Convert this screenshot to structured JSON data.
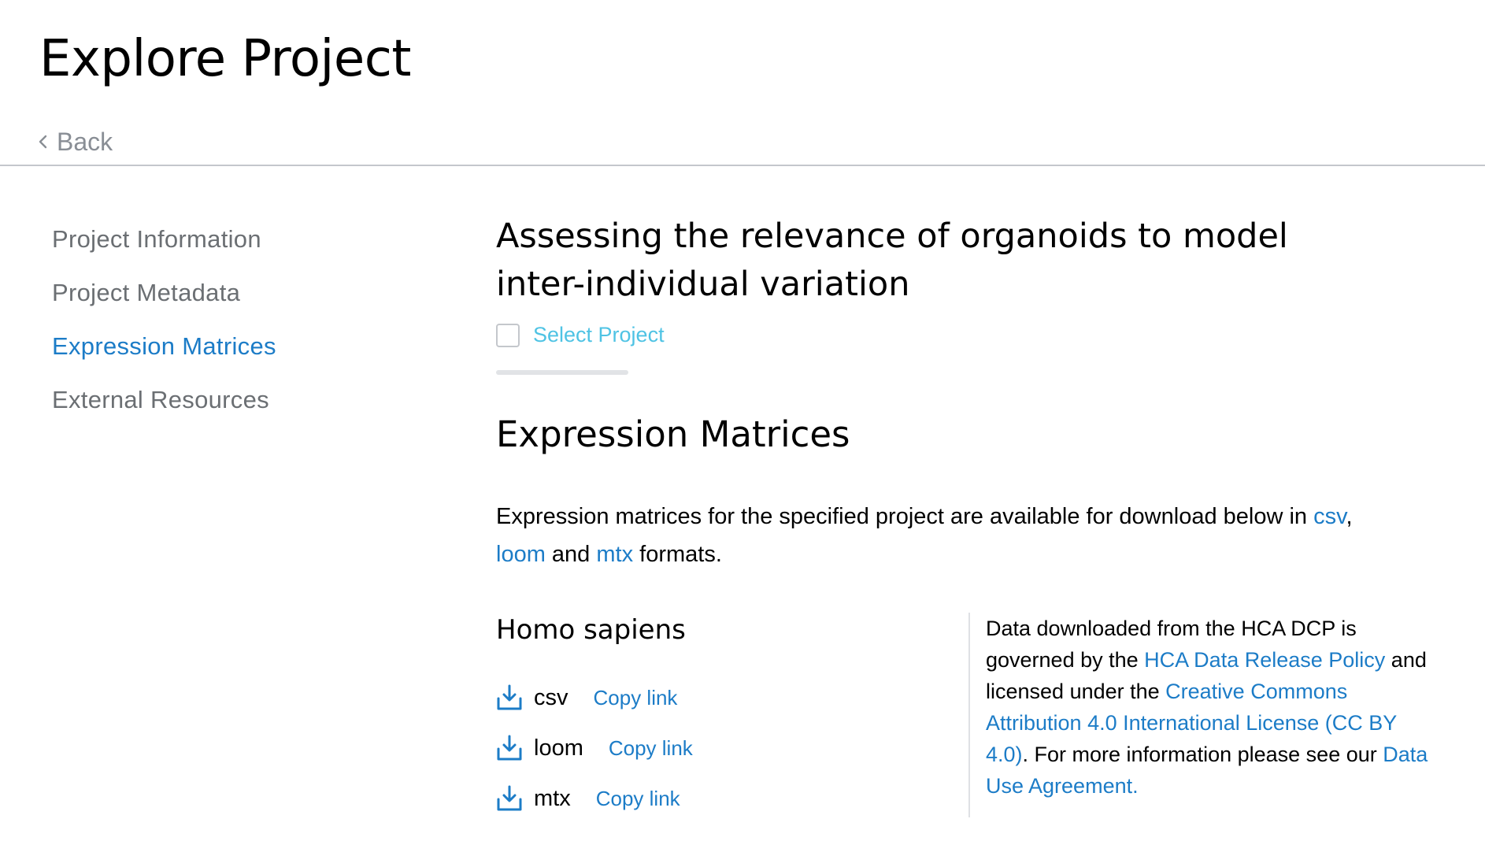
{
  "header": {
    "title": "Explore Project",
    "back_label": "Back"
  },
  "sidebar": {
    "items": [
      {
        "label": "Project Information",
        "active": false
      },
      {
        "label": "Project Metadata",
        "active": false
      },
      {
        "label": "Expression Matrices",
        "active": true
      },
      {
        "label": "External Resources",
        "active": false
      }
    ]
  },
  "main": {
    "project_title": "Assessing the relevance of organoids to model inter-individual variation",
    "select_label": "Select Project",
    "select_checked": false,
    "section_heading": "Expression Matrices",
    "intro": {
      "text_before": "Expression matrices for the specified project are available for download below in ",
      "link_csv": "csv",
      "comma": ",",
      "link_loom": "loom",
      "and": " and ",
      "link_mtx": "mtx",
      "text_after": " formats."
    },
    "species": {
      "name": "Homo sapiens",
      "files": [
        {
          "format": "csv",
          "copy_label": "Copy link"
        },
        {
          "format": "loom",
          "copy_label": "Copy link"
        },
        {
          "format": "mtx",
          "copy_label": "Copy link"
        }
      ]
    },
    "license": {
      "text1": "Data downloaded from the HCA DCP is governed by the ",
      "link_policy": "HCA Data Release Policy",
      "text2": " and licensed under the ",
      "link_license": "Creative Commons Attribution 4.0 International License (CC BY 4.0)",
      "text3": ". For more information please see our ",
      "link_agreement": "Data Use Agreement."
    }
  },
  "colors": {
    "accent": "#1c7cc7",
    "select_accent": "#4fc3e4",
    "muted_text": "#6b6f73",
    "divider": "#c4c7cc"
  }
}
